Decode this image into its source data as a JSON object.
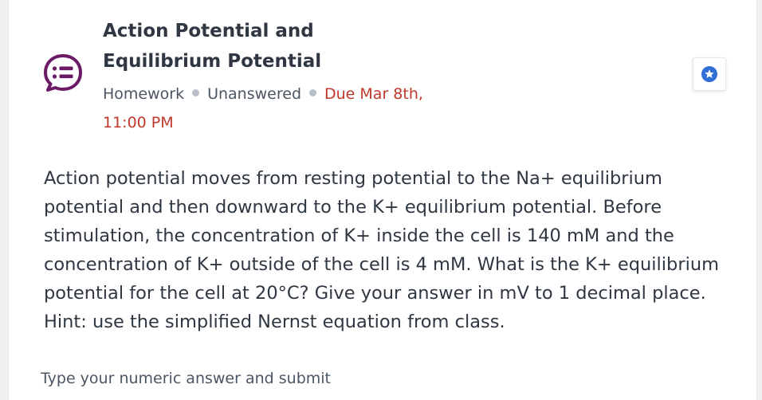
{
  "question_card": {
    "title": "Action Potential and Equilibrium Potential",
    "type": "Homework",
    "status": "Unanswered",
    "due": "Due Mar 8th, 11:00 PM",
    "body": "Action potential moves from resting potential to the Na+ equilibrium potential and then downward to the K+ equilibrium potential. Before stimulation, the concentration of K+ inside the cell is  140 mM and the concentration of K+ outside of the cell is 4 mM. What is the K+ equilibrium potential for the cell at 20°C? Give your answer in mV to 1 decimal place. Hint: use the simplified Nernst equation from class.",
    "answer_placeholder": "Type your numeric answer and submit",
    "icons": {
      "question_type": "question-chat-icon",
      "star": "star-icon"
    }
  },
  "colors": {
    "icon_purple": "#6b1a66",
    "due_red": "#c0392b",
    "star_blue": "#2f6fd6",
    "text_dark": "#2f3742"
  }
}
